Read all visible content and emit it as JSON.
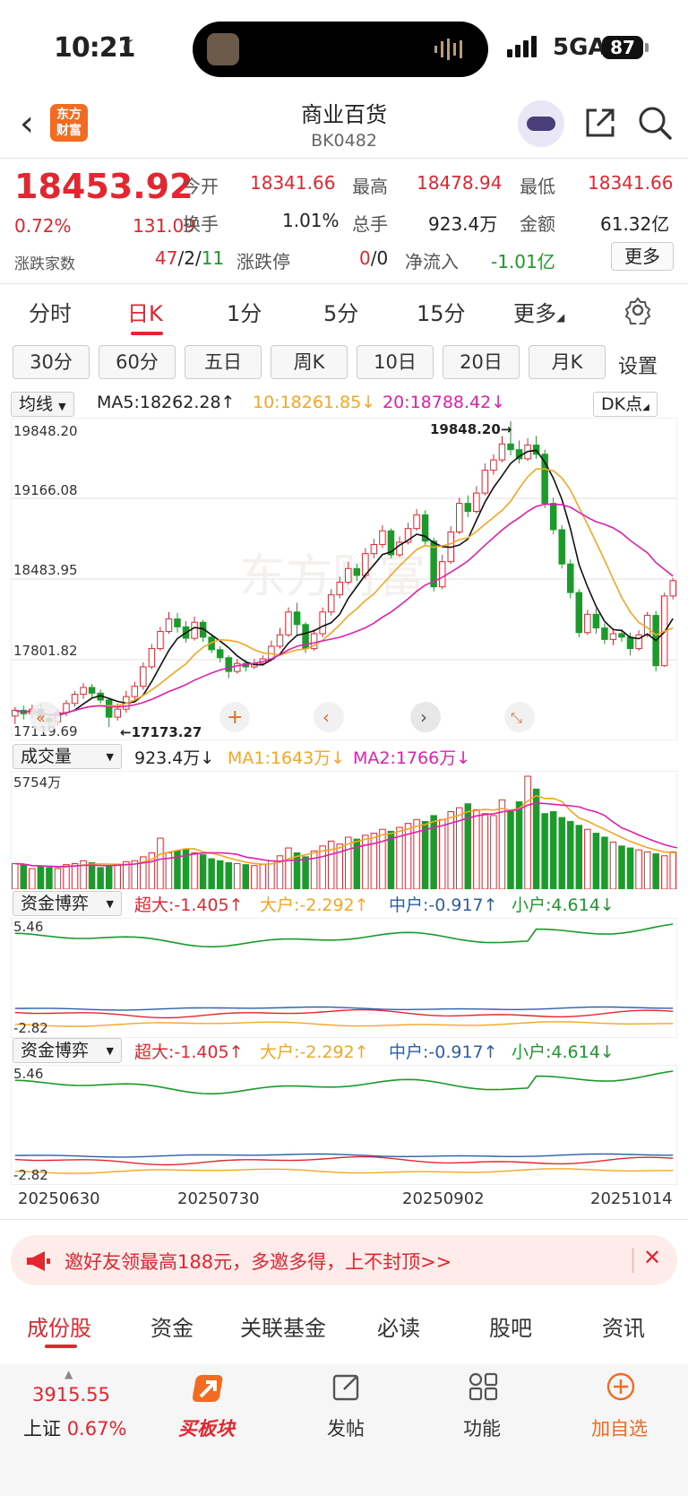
{
  "status_bar": {
    "time": "10:21",
    "network": "5GA",
    "battery": "87"
  },
  "header": {
    "logo_line1": "东方",
    "logo_line2": "财富",
    "title": "商业百货",
    "code": "BK0482"
  },
  "quote": {
    "price": "18453.92",
    "change_pct": "0.72%",
    "change": "131.09",
    "open_label": "今开",
    "open": "18341.66",
    "high_label": "最高",
    "high": "18478.94",
    "low_label": "最低",
    "low": "18341.66",
    "turnover_label": "换手",
    "turnover": "1.01%",
    "volume_label": "总手",
    "volume": "923.4万",
    "amount_label": "金额",
    "amount": "61.32亿",
    "breadth_label": "涨跌家数",
    "breadth_up": "47",
    "breadth_sep1": "/",
    "breadth_flat": "2",
    "breadth_sep2": "/",
    "breadth_down": "11",
    "limit_label": "涨跌停",
    "limit_up": "0",
    "limit_sep": "/",
    "limit_down": "0",
    "netflow_label": "净流入",
    "netflow": "-1.01亿",
    "more_label": "更多"
  },
  "period_tabs": [
    "分时",
    "日K",
    "1分",
    "5分",
    "15分",
    "更多"
  ],
  "period_buttons": [
    "30分",
    "60分",
    "五日",
    "周K",
    "10日",
    "20日",
    "月K"
  ],
  "settings_label": "设置",
  "ma_bar": {
    "selector": "均线",
    "ma5": "MA5:18262.28↑",
    "ma10": "10:18261.85↓",
    "ma20": "20:18788.42↓",
    "dk": "DK点"
  },
  "kline_axis": [
    "19848.20",
    "19166.08",
    "18483.95",
    "17801.82",
    "17119.69"
  ],
  "kline_markers": {
    "high": "19848.20→",
    "low": "←17173.27"
  },
  "volume_bar": {
    "selector": "成交量",
    "vol": "923.4万↓",
    "ma1": "MA1:1643万↓",
    "ma2": "MA2:1766万↓",
    "max": "5754万"
  },
  "flow_bar": {
    "selector": "资金博弈",
    "super": "超大:-1.405↑",
    "large": "大户:-2.292↑",
    "medium": "中户:-0.917↑",
    "small": "小户:4.614↓",
    "top": "5.46",
    "bottom": "-2.82"
  },
  "dates": [
    "20250630",
    "20250730",
    "20250902",
    "20251014"
  ],
  "banner": {
    "text": "邀好友领最高188元，多邀多得，上不封顶>>"
  },
  "bottom_tabs": [
    "成份股",
    "资金",
    "关联基金",
    "必读",
    "股吧",
    "资讯"
  ],
  "bottom_bar": {
    "index_value": "3915.55",
    "index_name": "上证",
    "index_pct": "0.67%",
    "buy_label": "买板块",
    "post_label": "发帖",
    "func_label": "功能",
    "add_label": "加自选"
  },
  "colors": {
    "up": "#e3262f",
    "down": "#1a9b2a",
    "ma10": "#f5a623",
    "ma20": "#e020b0",
    "accent": "#f36b21"
  },
  "chart_data": [
    {
      "type": "candlestick",
      "title": "",
      "ylim": [
        17119.69,
        19848.2
      ],
      "y_ticks": [
        19848.2,
        19166.08,
        18483.95,
        17801.82,
        17119.69
      ],
      "x_ticks": [
        "20250630",
        "20250730",
        "20250902",
        "20251014"
      ],
      "annotations": [
        {
          "text": "19848.20",
          "value": 19848.2
        },
        {
          "text": "17173.27",
          "value": 17173.27
        }
      ],
      "series": [
        {
          "name": "MA5",
          "last": 18262.28
        },
        {
          "name": "10",
          "last": 18261.85
        },
        {
          "name": "20",
          "last": 18788.42
        }
      ],
      "candles": [
        [
          17270,
          17320,
          17200,
          17350
        ],
        [
          17320,
          17290,
          17240,
          17360
        ],
        [
          17290,
          17330,
          17250,
          17370
        ],
        [
          17330,
          17250,
          17220,
          17380
        ],
        [
          17250,
          17220,
          17150,
          17290
        ],
        [
          17220,
          17300,
          17190,
          17330
        ],
        [
          17300,
          17380,
          17270,
          17410
        ],
        [
          17380,
          17460,
          17350,
          17490
        ],
        [
          17460,
          17520,
          17420,
          17560
        ],
        [
          17520,
          17470,
          17430,
          17550
        ],
        [
          17470,
          17410,
          17380,
          17500
        ],
        [
          17410,
          17260,
          17173,
          17430
        ],
        [
          17260,
          17330,
          17230,
          17380
        ],
        [
          17330,
          17440,
          17300,
          17490
        ],
        [
          17440,
          17530,
          17410,
          17570
        ],
        [
          17530,
          17700,
          17500,
          17740
        ],
        [
          17700,
          17860,
          17680,
          17900
        ],
        [
          17860,
          18010,
          17840,
          18050
        ],
        [
          18010,
          18120,
          17990,
          18180
        ],
        [
          18120,
          18050,
          18000,
          18170
        ],
        [
          18050,
          17950,
          17910,
          18100
        ],
        [
          17950,
          18090,
          17930,
          18140
        ],
        [
          18090,
          17960,
          17920,
          18110
        ],
        [
          17960,
          17850,
          17820,
          17990
        ],
        [
          17850,
          17780,
          17740,
          17880
        ],
        [
          17780,
          17660,
          17600,
          17800
        ],
        [
          17660,
          17730,
          17640,
          17770
        ],
        [
          17730,
          17700,
          17660,
          17760
        ],
        [
          17700,
          17730,
          17680,
          17770
        ],
        [
          17730,
          17770,
          17710,
          17800
        ],
        [
          17770,
          17880,
          17750,
          17930
        ],
        [
          17880,
          17980,
          17860,
          18040
        ],
        [
          17980,
          18180,
          17960,
          18220
        ],
        [
          18180,
          18070,
          17980,
          18260
        ],
        [
          18070,
          17860,
          17820,
          18090
        ],
        [
          17860,
          17990,
          17840,
          18030
        ],
        [
          17990,
          18180,
          17960,
          18220
        ],
        [
          18180,
          18330,
          18150,
          18380
        ],
        [
          18330,
          18440,
          18300,
          18490
        ],
        [
          18440,
          18560,
          18420,
          18620
        ],
        [
          18560,
          18500,
          18450,
          18600
        ],
        [
          18500,
          18690,
          18470,
          18740
        ],
        [
          18690,
          18770,
          18650,
          18820
        ],
        [
          18770,
          18890,
          18740,
          18940
        ],
        [
          18890,
          18680,
          18650,
          18910
        ],
        [
          18680,
          18790,
          18660,
          18840
        ],
        [
          18790,
          18910,
          18770,
          18960
        ],
        [
          18910,
          19030,
          18890,
          19080
        ],
        [
          19030,
          18800,
          18770,
          19070
        ],
        [
          18800,
          18400,
          18360,
          18830
        ],
        [
          18400,
          18620,
          18380,
          18680
        ],
        [
          18620,
          18880,
          18600,
          18930
        ],
        [
          18880,
          19130,
          18860,
          19180
        ],
        [
          19130,
          19060,
          19010,
          19200
        ],
        [
          19060,
          19220,
          19040,
          19280
        ],
        [
          19220,
          19420,
          19200,
          19480
        ],
        [
          19420,
          19510,
          19380,
          19560
        ],
        [
          19510,
          19650,
          19490,
          19720
        ],
        [
          19650,
          19600,
          19550,
          19848
        ],
        [
          19600,
          19520,
          19480,
          19680
        ],
        [
          19520,
          19640,
          19500,
          19700
        ],
        [
          19640,
          19560,
          19520,
          19720
        ],
        [
          19560,
          19130,
          19090,
          19600
        ],
        [
          19130,
          18900,
          18860,
          19180
        ],
        [
          18900,
          18600,
          18560,
          18940
        ],
        [
          18600,
          18350,
          18300,
          18640
        ],
        [
          18350,
          18000,
          17960,
          18380
        ],
        [
          18000,
          18160,
          17980,
          18200
        ],
        [
          18160,
          18040,
          17990,
          18210
        ],
        [
          18040,
          17940,
          17900,
          18080
        ],
        [
          17940,
          17990,
          17890,
          18040
        ],
        [
          17990,
          17960,
          17920,
          18030
        ],
        [
          17960,
          17860,
          17800,
          18000
        ],
        [
          17860,
          17980,
          17840,
          18020
        ],
        [
          17980,
          18150,
          17960,
          18180
        ],
        [
          18150,
          17710,
          17660,
          18190
        ],
        [
          17710,
          18320,
          17700,
          18350
        ],
        [
          18320,
          18454,
          18290,
          18478
        ]
      ]
    },
    {
      "type": "bar",
      "title": "成交量",
      "ylim": [
        0,
        5754
      ],
      "values": [
        1300,
        1250,
        1050,
        1150,
        1100,
        1050,
        1250,
        1300,
        1450,
        1350,
        1100,
        1200,
        1250,
        1400,
        1450,
        1650,
        1850,
        2600,
        1850,
        1950,
        2050,
        1850,
        1750,
        1550,
        1450,
        1350,
        1300,
        1250,
        1200,
        1250,
        1450,
        1700,
        2100,
        1850,
        1650,
        1950,
        2200,
        2450,
        2300,
        2650,
        2550,
        2750,
        2850,
        3050,
        2950,
        3150,
        3350,
        3550,
        3450,
        3750,
        3550,
        3950,
        4150,
        4350,
        4050,
        3850,
        3750,
        4550,
        3950,
        4450,
        5754,
        5100,
        3850,
        3950,
        3650,
        3450,
        3250,
        3050,
        2850,
        2650,
        2400,
        2200,
        2100,
        2000,
        1900,
        1800,
        1700,
        1900,
        2100,
        1010
      ]
    },
    {
      "type": "line",
      "title": "资金博弈",
      "ylim": [
        -2.82,
        5.46
      ],
      "series": [
        {
          "name": "小户",
          "last": 4.614
        },
        {
          "name": "超大",
          "last": -1.405
        },
        {
          "name": "大户",
          "last": -2.292
        },
        {
          "name": "中户",
          "last": -0.917
        }
      ]
    }
  ]
}
